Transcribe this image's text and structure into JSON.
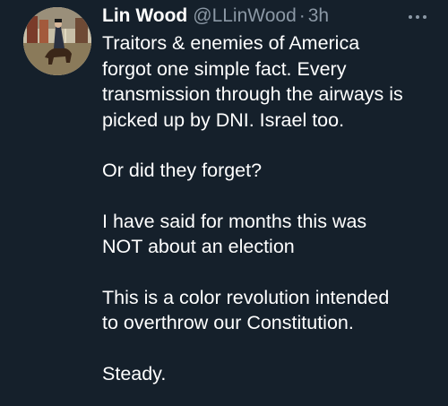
{
  "tweet": {
    "author": {
      "display_name": "Lin Wood",
      "handle": "@LLinWood",
      "separator": "·",
      "time": "3h"
    },
    "menu_icon": "more-horizontal-icon",
    "paragraphs": [
      "Traitors & enemies of America\nforgot one simple fact. Every\ntransmission through the airways is\npicked up by DNI. Israel too.",
      "Or did they forget?",
      "I have said for months this was\nNOT about an election",
      "This is a color revolution intended\nto overthrow our Constitution.",
      "Steady."
    ]
  },
  "colors": {
    "background": "#15202b",
    "primary_text": "#ffffff",
    "secondary_text": "#8b98a5"
  }
}
